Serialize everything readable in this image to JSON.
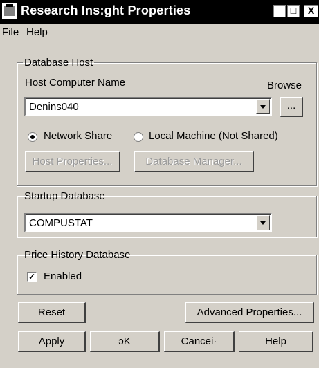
{
  "window": {
    "title": "Research Ins:ght Properties",
    "minimize": "_",
    "maximize": "□",
    "close": "X"
  },
  "menu": {
    "file": "File",
    "help": "Help"
  },
  "database_host": {
    "legend": "Database Host",
    "host_label": "Host Computer Name",
    "browse_label": "Browse",
    "host_value": "Denins040",
    "browse_button": "...",
    "network_share": "Network Share",
    "local_machine": "Local Machine (Not Shared)",
    "selected": "network_share",
    "host_properties": "Host Properties...",
    "database_manager": "Database Manager..."
  },
  "startup_database": {
    "legend": "Startup Database",
    "value": "COMPUSTAT"
  },
  "price_history": {
    "legend": "Price History Database",
    "enabled_label": "Enabled",
    "enabled": true,
    "check_mark": "✓"
  },
  "buttons": {
    "reset": "Reset",
    "advanced": "Advanced Properties...",
    "apply": "Apply",
    "ok": "ͻK",
    "cancel": "Cancei·",
    "help": "Help"
  }
}
